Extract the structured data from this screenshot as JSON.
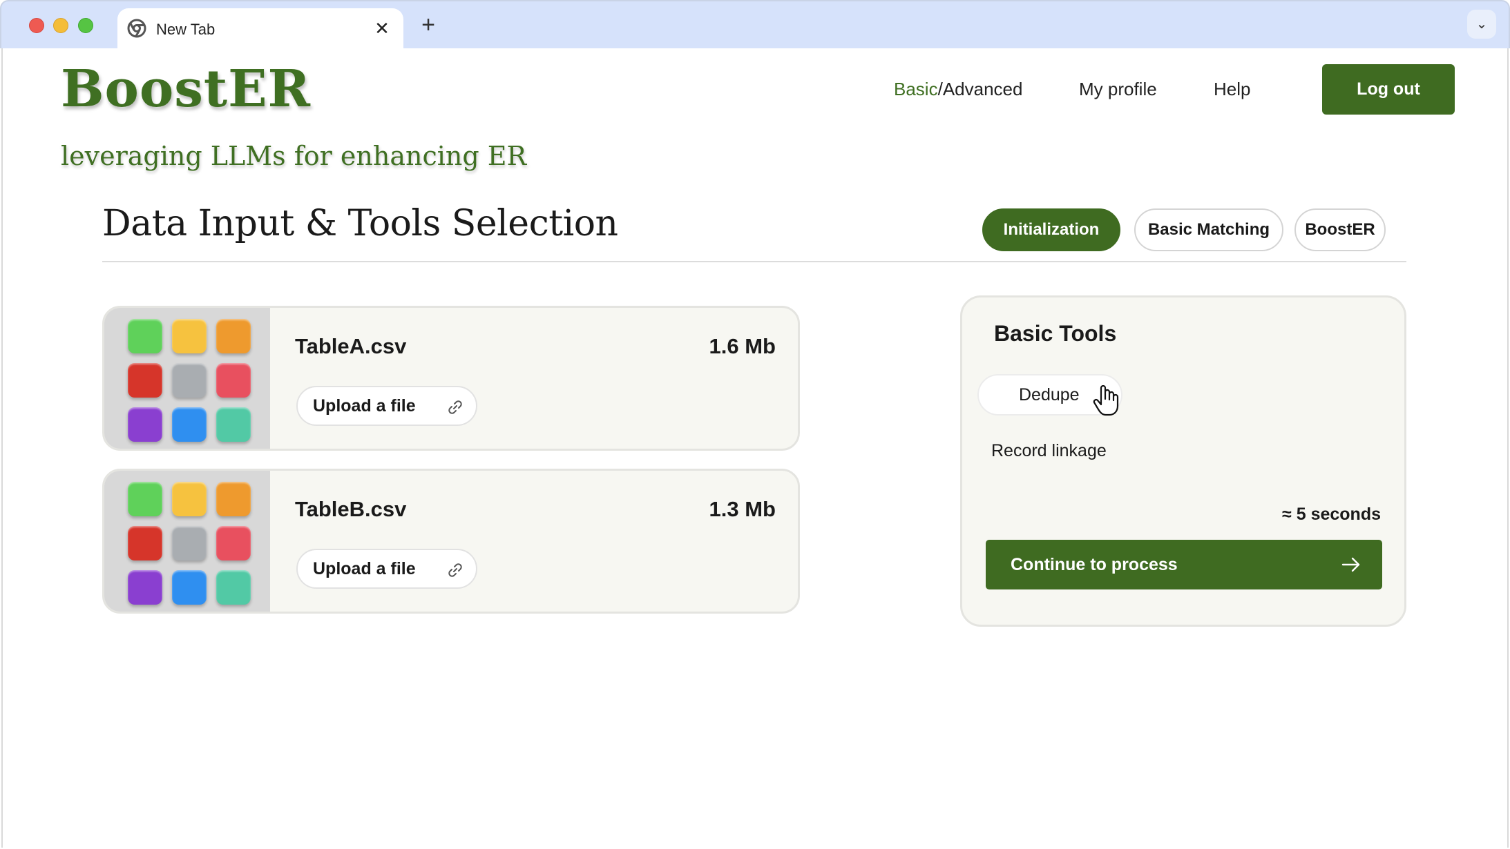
{
  "browser": {
    "tab_title": "New Tab",
    "tab_close": "✕",
    "new_tab": "+",
    "tab_menu": "⌄"
  },
  "header": {
    "brand": "BoostER",
    "tagline": "leveraging LLMs for enhancing ER",
    "nav_mode_basic": "Basic",
    "nav_mode_separator": "/",
    "nav_mode_advanced": "Advanced",
    "nav_profile": "My profile",
    "nav_help": "Help",
    "logout": "Log out"
  },
  "section": {
    "title": "Data Input & Tools Selection",
    "steps": [
      {
        "label": "Initialization",
        "active": true
      },
      {
        "label": "Basic Matching",
        "active": false
      },
      {
        "label": "BoostER",
        "active": false
      }
    ]
  },
  "files": [
    {
      "name": "TableA.csv",
      "size": "1.6 Mb",
      "upload_label": "Upload a file"
    },
    {
      "name": "TableB.csv",
      "size": "1.3 Mb",
      "upload_label": "Upload a file"
    }
  ],
  "thumbnail_tile_colors": [
    "#5fd15a",
    "#f6c23f",
    "#ee9a2e",
    "#d6352a",
    "#a9adb1",
    "#e8505f",
    "#8a3fd0",
    "#2f8ff0",
    "#52c9a5"
  ],
  "tools": {
    "title": "Basic Tools",
    "options": [
      "Dedupe",
      "Record linkage"
    ],
    "estimate": "≈ 5 seconds",
    "continue_label": "Continue to process"
  },
  "colors": {
    "accent": "#3f6b21",
    "brand_text": "#3f6f22",
    "chrome": "#d6e2fb",
    "card_bg": "#f7f7f2"
  },
  "icons": [
    "chrome-icon",
    "close-icon",
    "plus-icon",
    "chevron-down-icon",
    "link-icon",
    "hand-cursor-icon",
    "arrow-right-icon"
  ]
}
